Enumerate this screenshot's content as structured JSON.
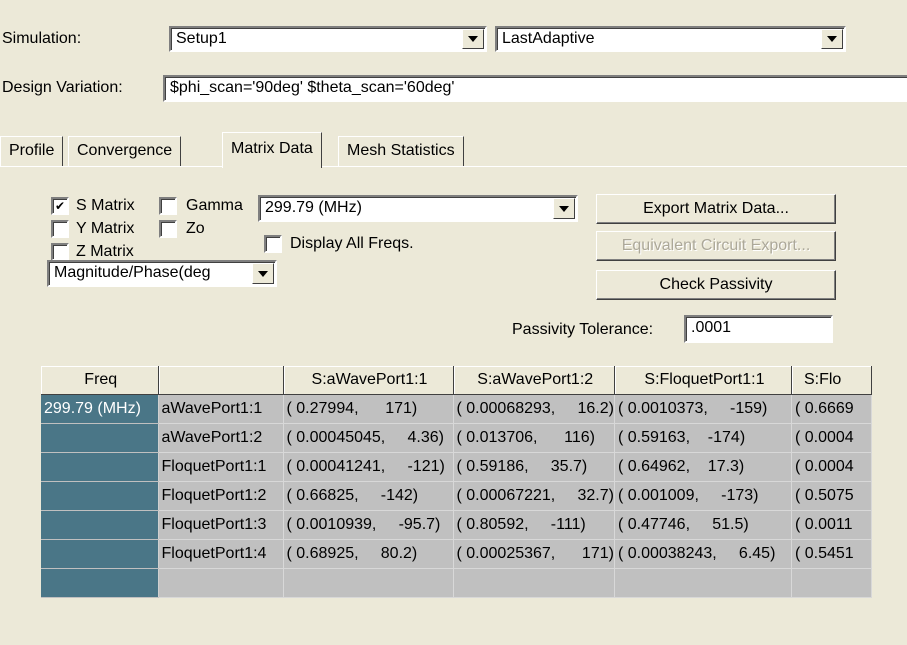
{
  "simulation": {
    "label": "Simulation:",
    "setup": "Setup1",
    "pass": "LastAdaptive"
  },
  "design_variation": {
    "label": "Design Variation:",
    "value": "$phi_scan='90deg' $theta_scan='60deg'"
  },
  "tabs": [
    {
      "label": "Profile",
      "active": false
    },
    {
      "label": "Convergence",
      "active": false
    },
    {
      "label": "Matrix Data",
      "active": true
    },
    {
      "label": "Mesh Statistics",
      "active": false
    }
  ],
  "options": {
    "s_matrix": {
      "label": "S Matrix",
      "checked": true
    },
    "gamma": {
      "label": "Gamma",
      "checked": false
    },
    "y_matrix": {
      "label": "Y Matrix",
      "checked": false
    },
    "zo": {
      "label": "Zo",
      "checked": false
    },
    "z_matrix": {
      "label": "Z Matrix",
      "checked": false
    },
    "display_all": {
      "label": "Display All Freqs.",
      "checked": false
    },
    "format": "Magnitude/Phase(deg",
    "frequency": "299.79 (MHz)"
  },
  "buttons": {
    "export": "Export Matrix Data...",
    "equivalent": "Equivalent Circuit Export...",
    "passivity": "Check Passivity"
  },
  "passivity_tolerance": {
    "label": "Passivity Tolerance:",
    "value": ".0001"
  },
  "table": {
    "headers": [
      "Freq",
      "",
      "S:aWavePort1:1",
      "S:aWavePort1:2",
      "S:FloquetPort1:1",
      "S:Flo"
    ],
    "freq": "299.79 (MHz)",
    "rows": [
      {
        "name": "aWavePort1:1",
        "cells": [
          "( 0.27994,      171)",
          "( 0.00068293,     16.2)",
          "( 0.0010373,     -159)",
          "( 0.6669"
        ]
      },
      {
        "name": "aWavePort1:2",
        "cells": [
          "( 0.00045045,     4.36)",
          "( 0.013706,      116)",
          "( 0.59163,    -174)",
          "( 0.0004"
        ]
      },
      {
        "name": "FloquetPort1:1",
        "cells": [
          "( 0.00041241,     -121)",
          "( 0.59186,     35.7)",
          "( 0.64962,    17.3)",
          "( 0.0004"
        ]
      },
      {
        "name": "FloquetPort1:2",
        "cells": [
          "( 0.66825,     -142)",
          "( 0.00067221,     32.7)",
          "( 0.001009,     -173)",
          "( 0.5075"
        ]
      },
      {
        "name": "FloquetPort1:3",
        "cells": [
          "( 0.0010939,     -95.7)",
          "( 0.80592,     -111)",
          "( 0.47746,     51.5)",
          "( 0.0011"
        ]
      },
      {
        "name": "FloquetPort1:4",
        "cells": [
          "( 0.68925,     80.2)",
          "( 0.00025367,      171)",
          "( 0.00038243,     6.45)",
          "( 0.5451"
        ]
      }
    ]
  }
}
